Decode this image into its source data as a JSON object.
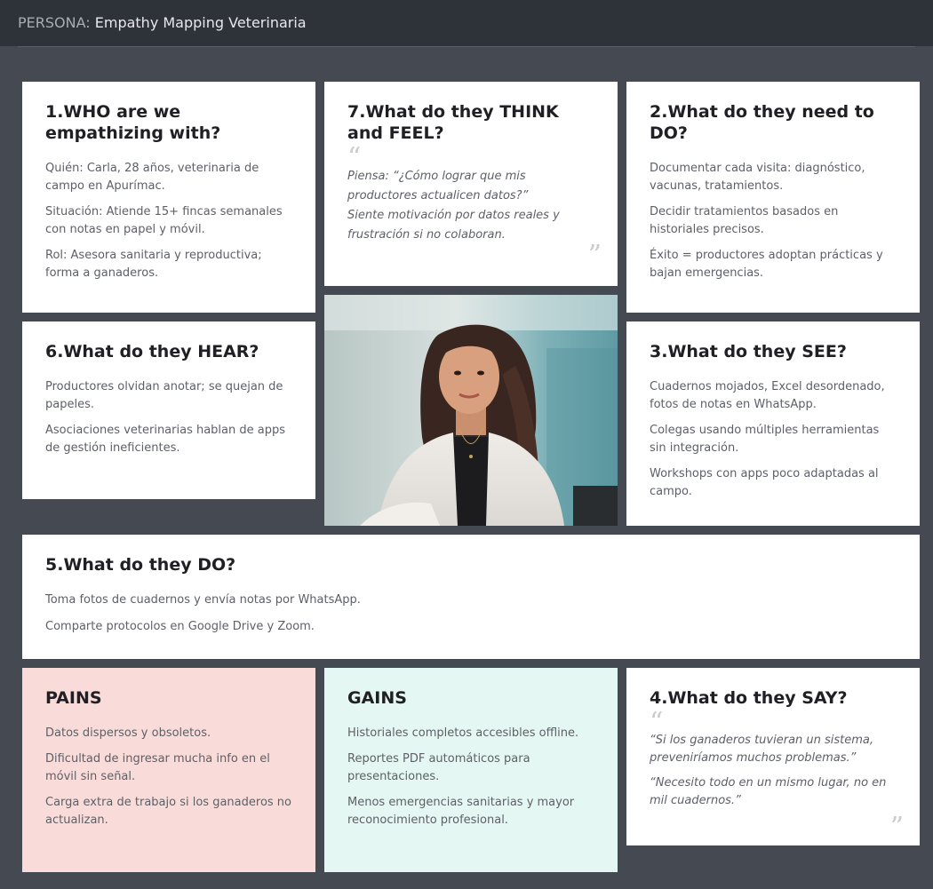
{
  "header": {
    "prefix": "PERSONA:",
    "title": "Empathy Mapping Veterinaria"
  },
  "who": {
    "title": "1.WHO are we empathizing with?",
    "items": [
      "Quién: Carla, 28 años, veterinaria de campo en Apurímac.",
      "Situación: Atiende 15+ fincas semanales con notas en papel y móvil.",
      "Rol: Asesora sanitaria y reproductiva; forma a ganaderos."
    ]
  },
  "think": {
    "title": "7.What do they THINK and FEEL?",
    "lines": [
      "Piensa: “¿Cómo lograr que mis productores actualicen datos?”",
      "Siente motivación por datos reales y frustración si no colaboran."
    ]
  },
  "need": {
    "title": "2.What do they need to DO?",
    "items": [
      "Documentar cada visita: diagnóstico, vacunas, tratamientos.",
      "Decidir tratamientos basados en historiales precisos.",
      "Éxito = productores adoptan prácticas y bajan emergencias."
    ]
  },
  "hear": {
    "title": "6.What do they HEAR?",
    "items": [
      "Productores olvidan anotar; se quejan de papeles.",
      "Asociaciones veterinarias hablan de apps de gestión ineficientes."
    ]
  },
  "see": {
    "title": "3.What do they SEE?",
    "items": [
      "Cuadernos mojados, Excel desordenado, fotos de notas en WhatsApp.",
      "Colegas usando múltiples herramientas sin integración.",
      "Workshops con apps poco adaptadas al campo."
    ]
  },
  "do": {
    "title": "5.What do they DO?",
    "items": [
      "Toma fotos de cuadernos y envía notas por WhatsApp.",
      "Comparte protocolos en Google Drive y Zoom."
    ]
  },
  "pains": {
    "title": "PAINS",
    "items": [
      "Datos dispersos y obsoletos.",
      "Dificultad de ingresar mucha info en el móvil sin señal.",
      "Carga extra de trabajo si los ganaderos no actualizan."
    ]
  },
  "gains": {
    "title": "GAINS",
    "items": [
      "Historiales completos accesibles offline.",
      "Reportes PDF automáticos para presentaciones.",
      "Menos emergencias sanitarias y mayor reconocimiento profesional."
    ]
  },
  "say": {
    "title": "4.What do they SAY?",
    "quotes": [
      "“Si los ganaderos tuvieran un sistema, preveniríamos muchos problemas.”",
      "“Necesito todo en un mismo lugar, no en mil cuadernos.”"
    ]
  },
  "colors": {
    "background": "#444952",
    "header": "#2e3239",
    "pains": "#f9dcd9",
    "gains": "#e5f7f2"
  }
}
